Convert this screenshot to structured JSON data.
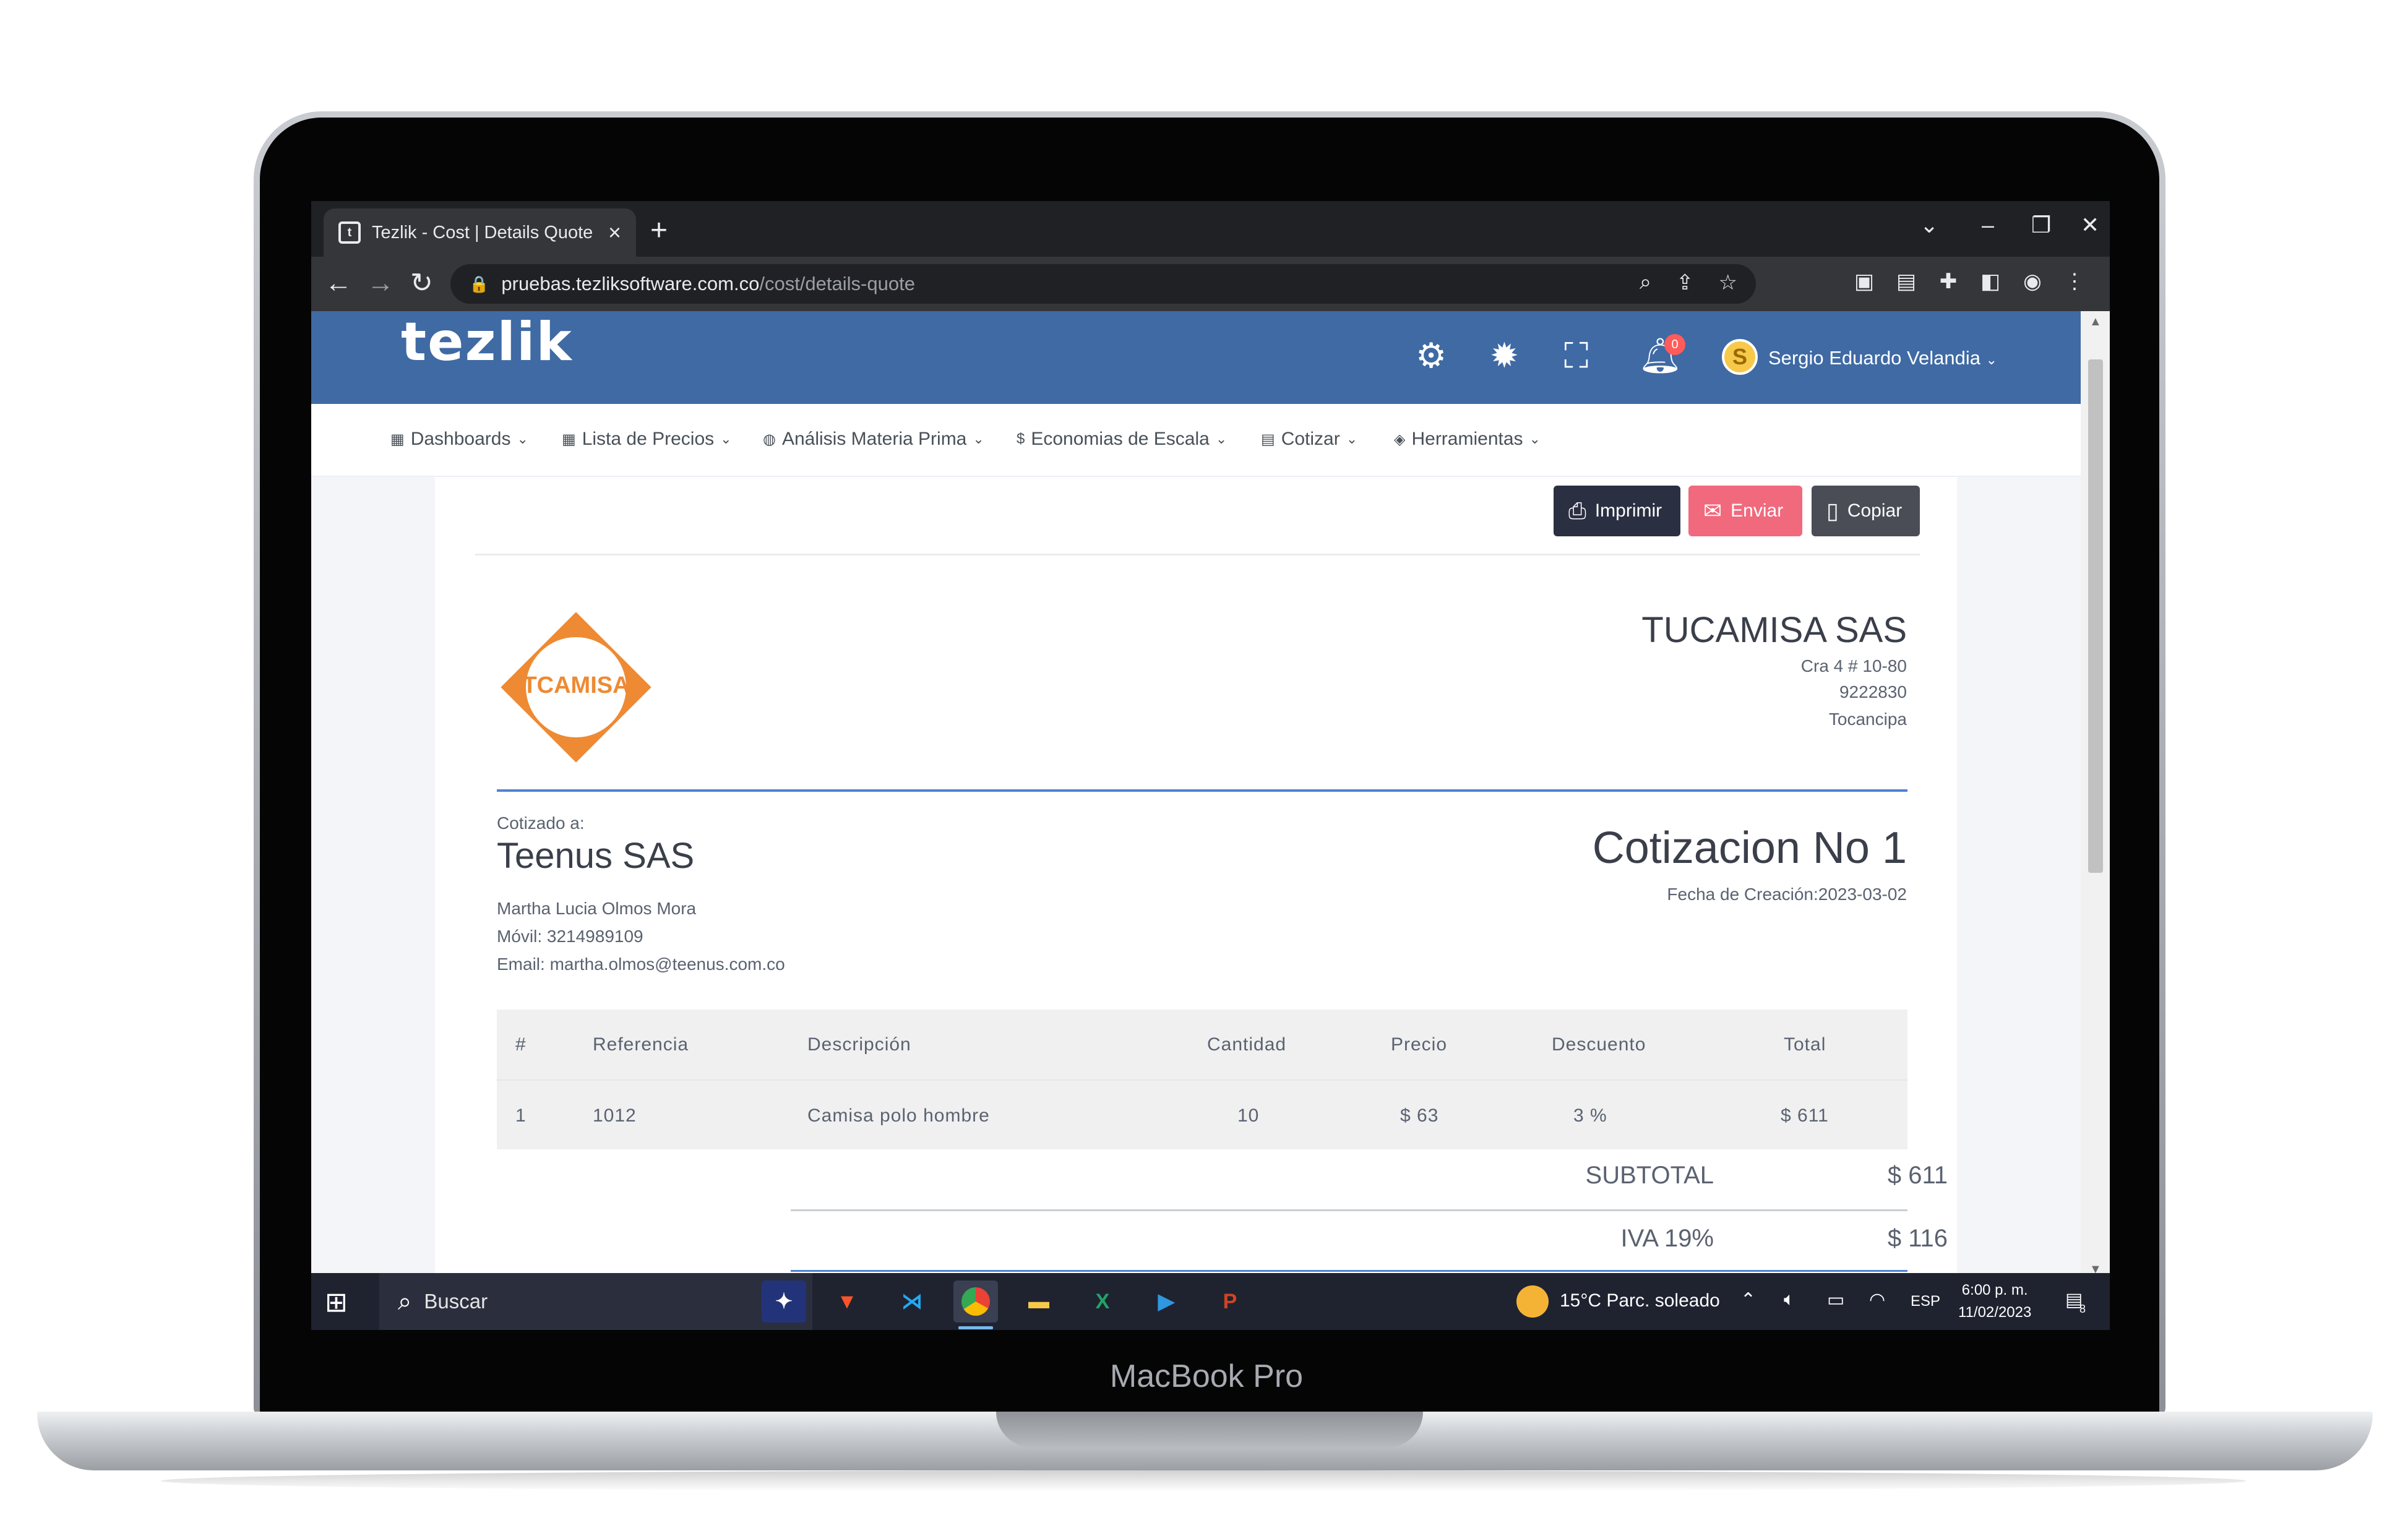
{
  "device": {
    "brand": "MacBook Pro"
  },
  "browser": {
    "tab_title": "Tezlik - Cost | Details Quote",
    "url_host": "pruebas.tezliksoftware.com.co",
    "url_path": "/cost/details-quote"
  },
  "app": {
    "logo_text": "tezlik",
    "notification_count": "0",
    "user_initial": "S",
    "user_name": "Sergio Eduardo Velandia",
    "menu": [
      "Dashboards",
      "Lista de Precios",
      "Análisis Materia Prima",
      "Economias de Escala",
      "Cotizar",
      "Herramientas"
    ]
  },
  "actions": {
    "print": "Imprimir",
    "send": "Enviar",
    "copy": "Copiar"
  },
  "company": {
    "logo_text": "TCAMISA",
    "name": "TUCAMISA SAS",
    "address": "Cra 4 # 10-80",
    "phone": "9222830",
    "city": "Tocancipa"
  },
  "client": {
    "label": "Cotizado a:",
    "name": "Teenus SAS",
    "contact": "Martha Lucia Olmos Mora",
    "mobile": "Móvil: 3214989109",
    "email": "Email: martha.olmos@teenus.com.co"
  },
  "quote": {
    "title": "Cotizacion No 1",
    "date": "Fecha de Creación:2023-03-02"
  },
  "table": {
    "headers": [
      "#",
      "Referencia",
      "Descripción",
      "Cantidad",
      "Precio",
      "Descuento",
      "Total"
    ],
    "rows": [
      [
        "1",
        "1012",
        "Camisa polo hombre",
        "10",
        "$ 63",
        "3 %",
        "$ 611"
      ]
    ]
  },
  "totals": {
    "subtotal_label": "SUBTOTAL",
    "subtotal_value": "$ 611",
    "iva_label": "IVA 19%",
    "iva_value": "$ 116"
  },
  "taskbar": {
    "search": "Buscar",
    "weather": "15°C  Parc. soleado",
    "lang": "ESP",
    "time": "6:00 p. m.",
    "date": "11/02/2023",
    "notif_count": "8"
  },
  "colors": {
    "header_blue": "#3f6aa4",
    "accent_blue": "#4d83d1",
    "send_pink": "#f1697c",
    "print_dark": "#2b2f42",
    "logo_orange": "#ee8a33"
  }
}
